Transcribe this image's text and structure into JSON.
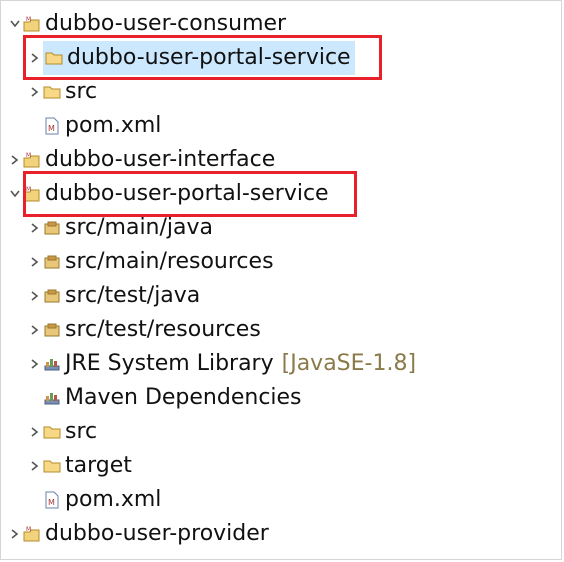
{
  "tree": {
    "items": [
      {
        "label": "dubbo-user-consumer",
        "type": "project",
        "expanded": true
      },
      {
        "label": "dubbo-user-portal-service",
        "type": "folder",
        "expanded": false,
        "selected": true
      },
      {
        "label": "src",
        "type": "folder",
        "expanded": false
      },
      {
        "label": "pom.xml",
        "type": "pom"
      },
      {
        "label": "dubbo-user-interface",
        "type": "project",
        "expanded": false
      },
      {
        "label": "dubbo-user-portal-service",
        "type": "project",
        "expanded": true
      },
      {
        "label": "src/main/java",
        "type": "source-folder",
        "expanded": false
      },
      {
        "label": "src/main/resources",
        "type": "source-folder",
        "expanded": false
      },
      {
        "label": "src/test/java",
        "type": "source-folder",
        "expanded": false
      },
      {
        "label": "src/test/resources",
        "type": "source-folder",
        "expanded": false
      },
      {
        "label": "JRE System Library",
        "decoration": "[JavaSE-1.8]",
        "type": "library",
        "expanded": false
      },
      {
        "label": "Maven Dependencies",
        "type": "library"
      },
      {
        "label": "src",
        "type": "folder",
        "expanded": false
      },
      {
        "label": "target",
        "type": "folder",
        "expanded": false
      },
      {
        "label": "pom.xml",
        "type": "pom"
      },
      {
        "label": "dubbo-user-provider",
        "type": "project",
        "expanded": false
      }
    ]
  },
  "colors": {
    "highlight_border": "#e8202a",
    "selection_bg": "#cce8ff",
    "decoration_text": "#8a7a4a"
  }
}
